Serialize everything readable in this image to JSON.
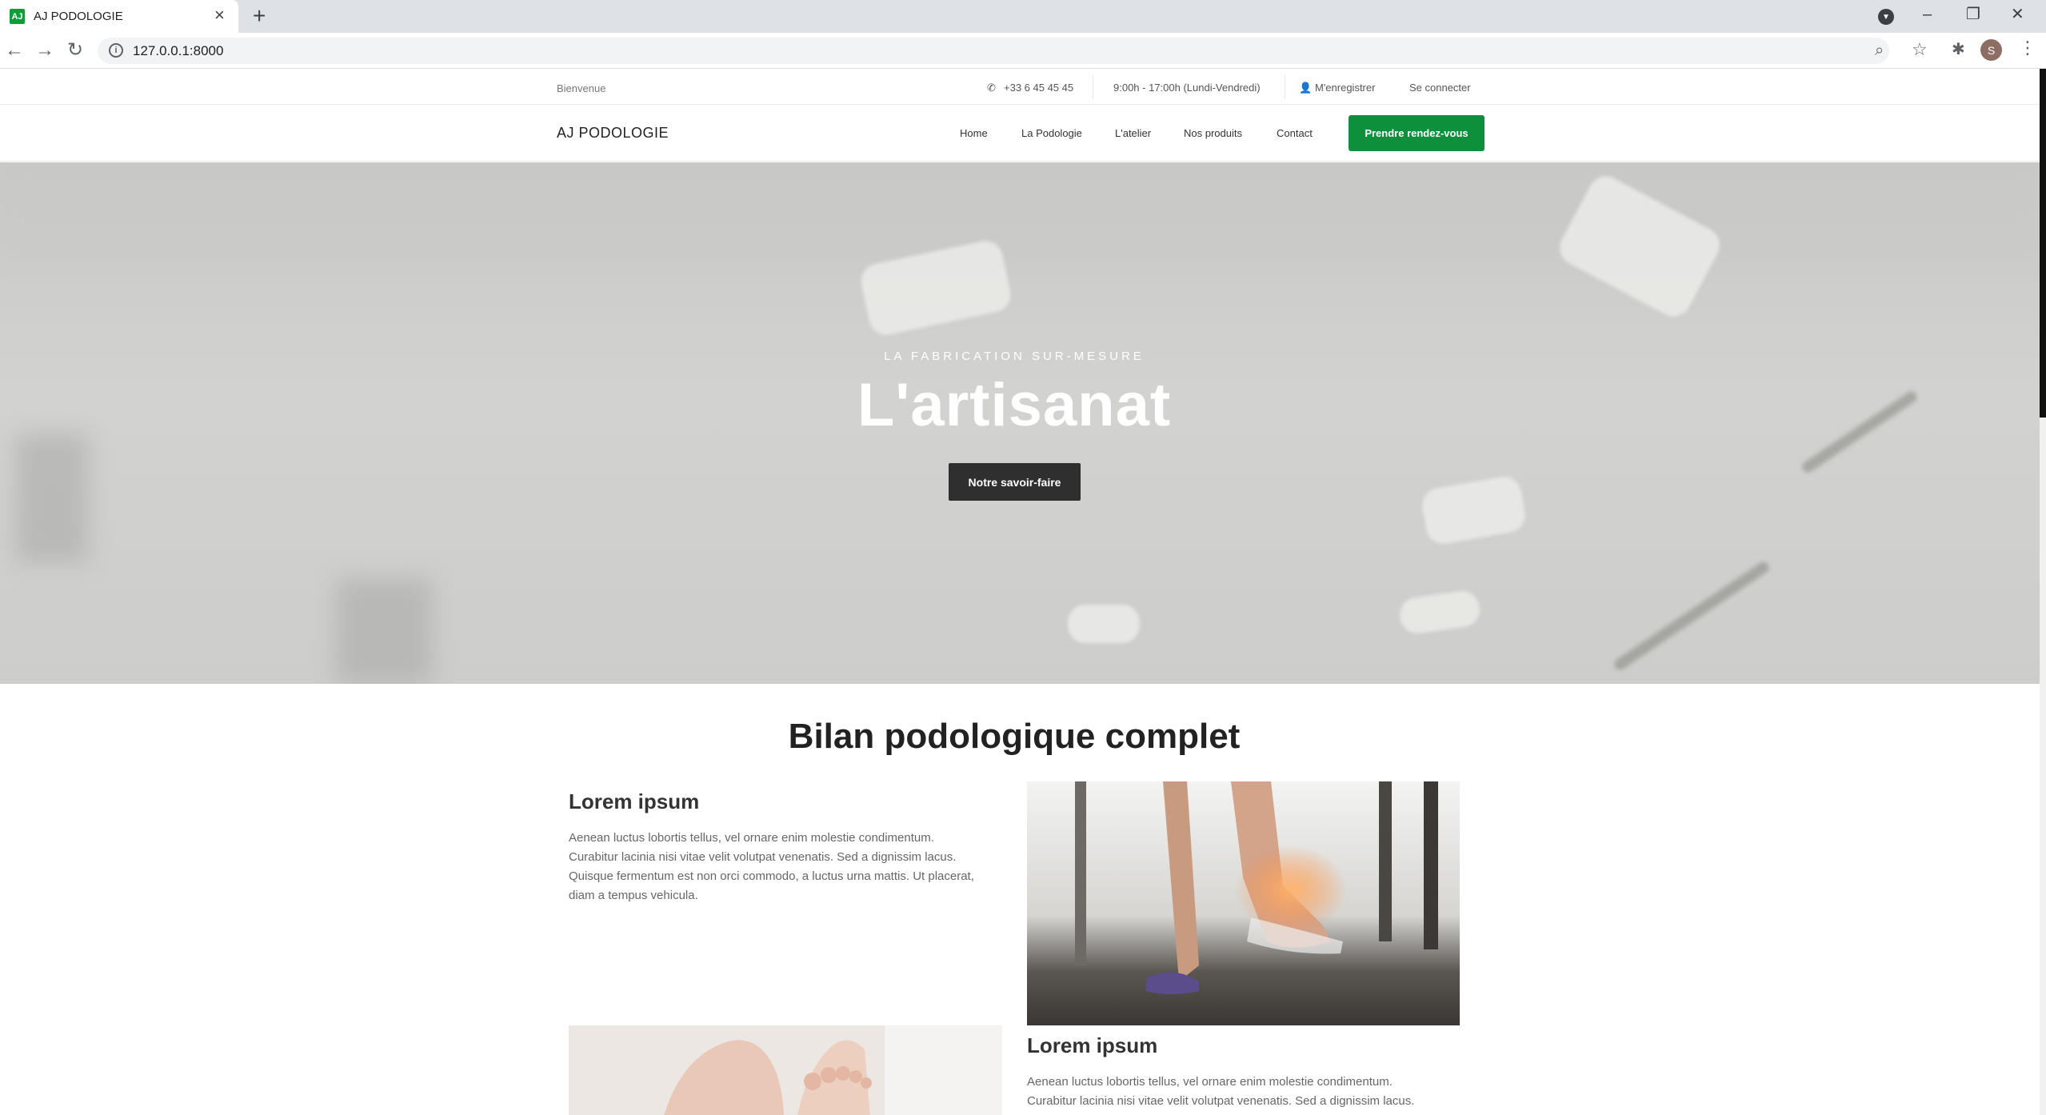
{
  "browser": {
    "tab_title": "AJ PODOLOGIE",
    "favicon_text": "AJ",
    "url": "127.0.0.1:8000",
    "profile_initial": "S"
  },
  "topbar": {
    "welcome": "Bienvenue",
    "phone": "+33 6 45 45 45",
    "hours": "9:00h - 17:00h (Lundi-Vendredi)",
    "register": "M'enregistrer",
    "login": "Se connecter"
  },
  "nav": {
    "brand": "AJ PODOLOGIE",
    "links": [
      "Home",
      "La Podologie",
      "L'atelier",
      "Nos produits",
      "Contact"
    ],
    "cta": "Prendre rendez-vous"
  },
  "hero": {
    "subtitle": "LA FABRICATION SUR-MESURE",
    "title": "L'artisanat",
    "button": "Notre savoir-faire",
    "slides": 3,
    "active_slide": 2
  },
  "section": {
    "title": "Bilan podologique complet",
    "cards": [
      {
        "heading": "Lorem ipsum",
        "lines": [
          "Aenean luctus lobortis tellus, vel ornare enim molestie condimentum.",
          "Curabitur lacinia nisi vitae velit volutpat venenatis. Sed a dignissim lacus.",
          "Quisque fermentum est non orci commodo, a luctus urna mattis. Ut placerat,",
          "diam a tempus vehicula."
        ]
      },
      {
        "heading": "Lorem ipsum",
        "lines": [
          "Aenean luctus lobortis tellus, vel ornare enim molestie condimentum.",
          "Curabitur lacinia nisi vitae velit volutpat venenatis. Sed a dignissim lacus."
        ]
      }
    ]
  },
  "colors": {
    "brand_green": "#0e8f3b",
    "dark_button": "#2f2f2f"
  }
}
